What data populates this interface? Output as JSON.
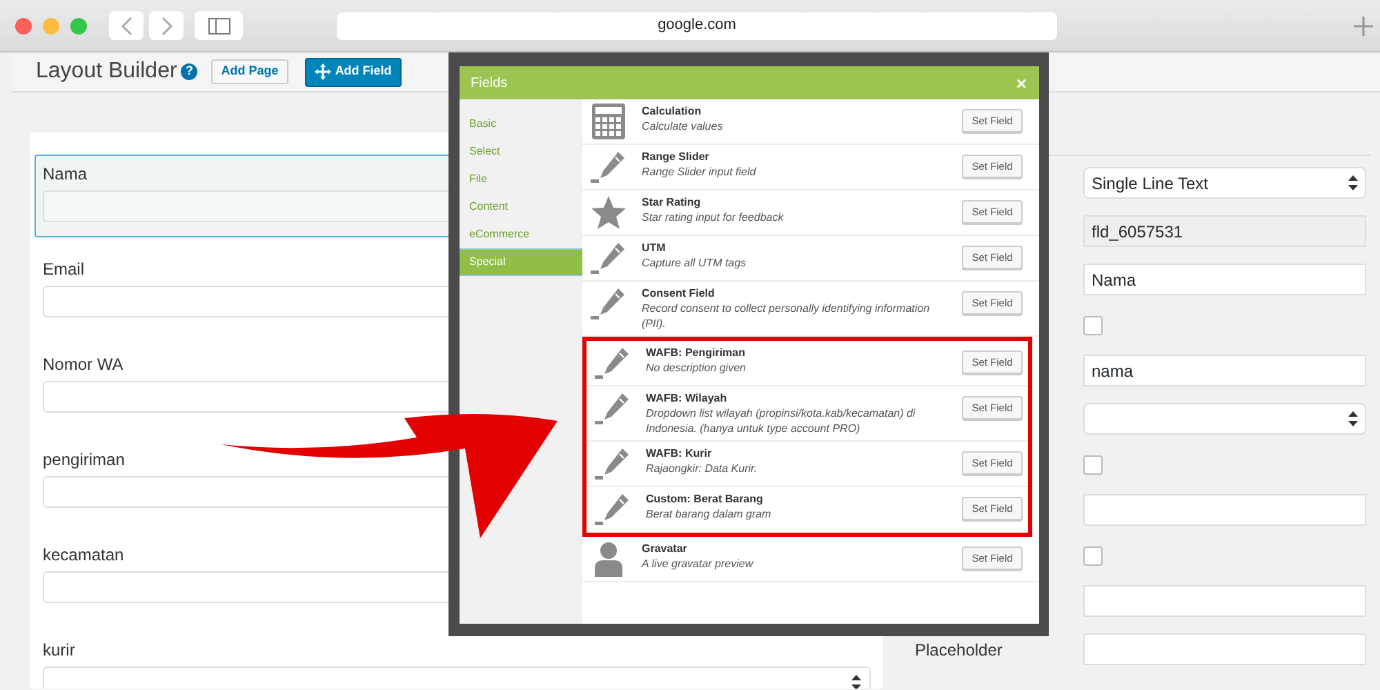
{
  "browser": {
    "url": "google.com"
  },
  "header": {
    "title": "Layout Builder",
    "help": "?",
    "buttons": [
      {
        "label": "Add Page",
        "kind": "secondary"
      },
      {
        "label": "Add Field",
        "kind": "primary"
      }
    ]
  },
  "form": {
    "fields": [
      {
        "label": "Nama",
        "kind": "text",
        "selected": true
      },
      {
        "label": "Email",
        "kind": "text",
        "selected": false
      },
      {
        "label": "Nomor WA",
        "kind": "text",
        "selected": false
      },
      {
        "label": "pengiriman",
        "kind": "text",
        "selected": false
      },
      {
        "label": "kecamatan",
        "kind": "text",
        "selected": false
      },
      {
        "label": "kurir",
        "kind": "select",
        "selected": false
      }
    ]
  },
  "settings": {
    "rows": [
      {
        "kind": "select",
        "value": "Single Line Text"
      },
      {
        "kind": "readonly",
        "value": "fld_6057531"
      },
      {
        "kind": "text",
        "value": "Nama"
      },
      {
        "kind": "checkbox",
        "checked": false
      },
      {
        "kind": "text",
        "value": "nama"
      },
      {
        "kind": "select"
      },
      {
        "kind": "checkbox",
        "checked": false
      },
      {
        "kind": "text"
      },
      {
        "kind": "checkbox",
        "checked": false
      },
      {
        "kind": "text"
      },
      {
        "kind": "text",
        "label": "Placeholder"
      }
    ]
  },
  "modal": {
    "title": "Fields",
    "close": "×",
    "categories": [
      {
        "label": "Basic",
        "selected": false
      },
      {
        "label": "Select",
        "selected": false
      },
      {
        "label": "File",
        "selected": false
      },
      {
        "label": "Content",
        "selected": false
      },
      {
        "label": "eCommerce",
        "selected": false
      },
      {
        "label": "Special",
        "selected": true
      }
    ],
    "fields": [
      {
        "title": "Calculation",
        "description": "Calculate values",
        "kind": "calculator",
        "highlighted": false,
        "button": "Set Field"
      },
      {
        "title": "Range Slider",
        "description": "Range Slider input field",
        "kind": "pencil",
        "highlighted": false,
        "button": "Set Field"
      },
      {
        "title": "Star Rating",
        "description": "Star rating input for feedback",
        "kind": "star",
        "highlighted": false,
        "button": "Set Field"
      },
      {
        "title": "UTM",
        "description": "Capture all UTM tags",
        "kind": "pencil",
        "highlighted": false,
        "button": "Set Field"
      },
      {
        "title": "Consent Field",
        "description": "Record consent to collect personally identifying information (PII).",
        "kind": "pencil",
        "highlighted": false,
        "button": "Set Field"
      },
      {
        "title": "WAFB: Pengiriman",
        "description": "No description given",
        "kind": "pencil",
        "highlighted": true,
        "button": "Set Field"
      },
      {
        "title": "WAFB: Wilayah",
        "description": "Dropdown list wilayah (propinsi/kota.kab/kecamatan) di Indonesia. (hanya untuk type account PRO)",
        "kind": "pencil",
        "highlighted": true,
        "button": "Set Field"
      },
      {
        "title": "WAFB: Kurir",
        "description": "Rajaongkir: Data Kurir.",
        "kind": "pencil",
        "highlighted": true,
        "button": "Set Field"
      },
      {
        "title": "Custom: Berat Barang",
        "description": "Berat barang dalam gram",
        "kind": "pencil",
        "highlighted": true,
        "button": "Set Field"
      },
      {
        "title": "Gravatar",
        "description": "A live gravatar preview",
        "kind": "person",
        "highlighted": false,
        "button": "Set Field"
      }
    ]
  }
}
